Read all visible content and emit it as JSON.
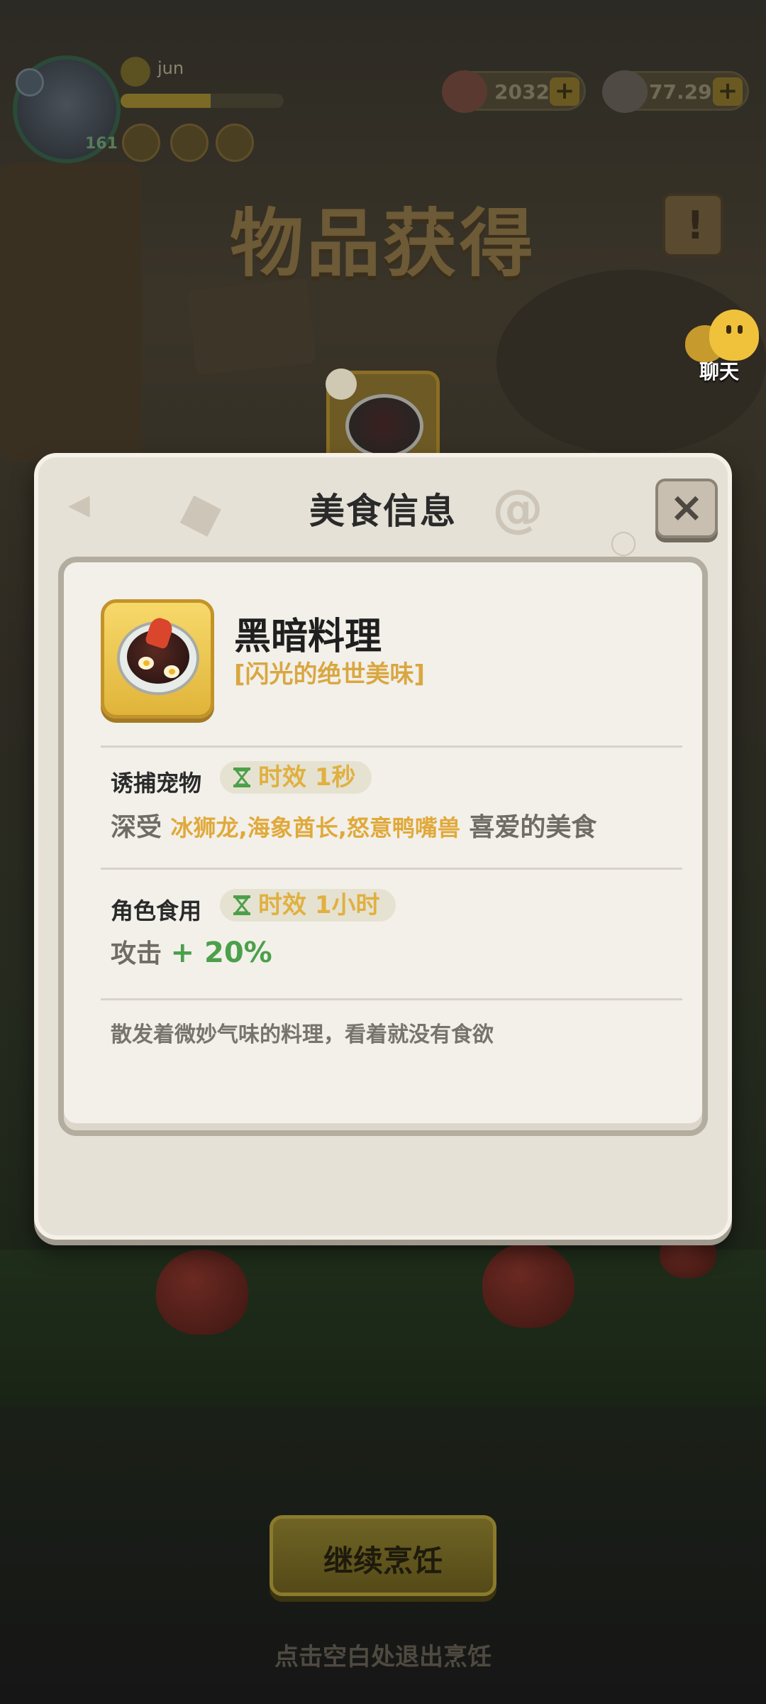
{
  "hud": {
    "player_name": "jun",
    "level": "161",
    "xp_fraction": 0.55,
    "currency_1": "2032",
    "currency_2": "77.29M",
    "plus_symbol": "+",
    "icons": [
      "avatar-icon",
      "shield-icon",
      "crystal-icon",
      "hat-icon",
      "pet-icon",
      "meat-icon",
      "pearl-icon"
    ]
  },
  "page": {
    "title": "物品获得",
    "scroll_glyph": "!",
    "chat_label": "聊天"
  },
  "modal": {
    "title": "美食信息",
    "close_glyph": "×",
    "food_name": "黑暗料理",
    "food_subtitle": "[闪光的绝世美味]",
    "lure": {
      "label": "诱捕宠物",
      "timer": "时效 1秒",
      "prefix": "深受 ",
      "pets": "冰狮龙,海象酋长,怒意鸭嘴兽",
      "suffix": " 喜爱的美食"
    },
    "eat": {
      "label": "角色食用",
      "timer": "时效 1小时",
      "stat": "攻击 ",
      "bonus": "+ 20%"
    },
    "flavor_text": "散发着微妙气味的料理，看着就没有食欲"
  },
  "footer": {
    "continue_label": "继续烹饪",
    "exit_hint": "点击空白处退出烹饪"
  },
  "colors": {
    "accent_gold": "#e0a93a",
    "bonus_green": "#4ba04a",
    "modal_bg": "#e6e1d7"
  }
}
